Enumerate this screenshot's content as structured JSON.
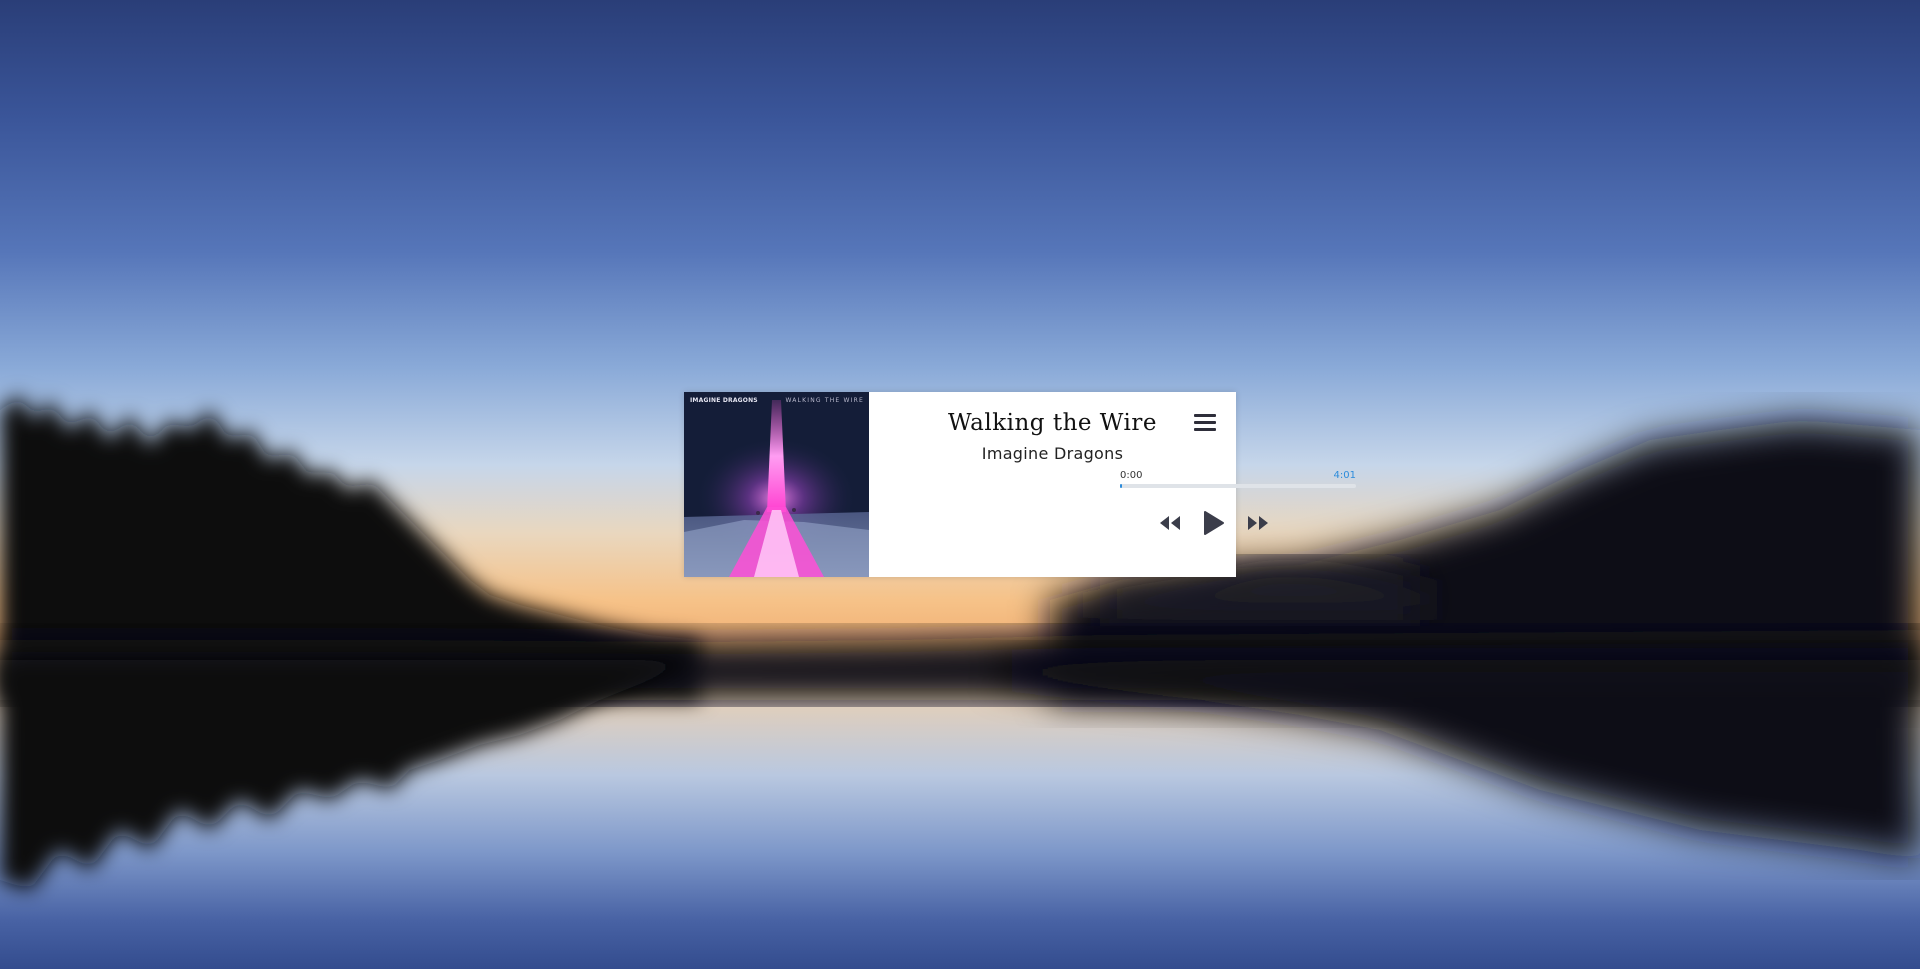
{
  "player": {
    "cover_band_text": "IMAGINE DRAGONS",
    "cover_album_text": "WALKING THE WIRE",
    "title": "Walking the Wire",
    "artist": "Imagine Dragons",
    "time_current": "0:00",
    "time_total": "4:01",
    "progress_fraction": 0.0,
    "accent_color": "#2d8cdb",
    "icons": {
      "menu": "hamburger-menu-icon",
      "previous": "rewind-icon",
      "play": "play-icon",
      "next": "fast-forward-icon"
    }
  }
}
